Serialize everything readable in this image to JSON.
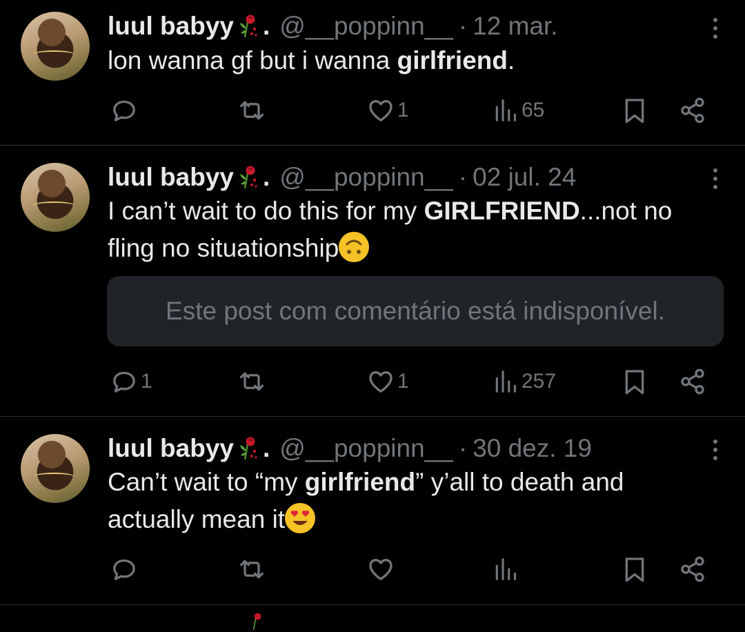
{
  "tweets": [
    {
      "name": "luul babyy",
      "name_suffix": ".",
      "handle": "@__poppinn__",
      "separator": "·",
      "date": "12 mar.",
      "text_parts": [
        "lon wanna gf but i wanna ",
        "girlfriend",
        "."
      ],
      "replies": "",
      "retweets": "",
      "likes": "1",
      "views": "65"
    },
    {
      "name": "luul babyy",
      "name_suffix": ".",
      "handle": "@__poppinn__",
      "separator": "·",
      "date": "02 jul. 24",
      "text_parts": [
        "I can’t wait to do this for my ",
        "GIRLFRIEND",
        "...not no fling no situationship"
      ],
      "emoji": "upside-down-face-emoji",
      "quote_text": "Este post com comentário está indisponível.",
      "replies": "1",
      "retweets": "",
      "likes": "1",
      "views": "257"
    },
    {
      "name": "luul babyy",
      "name_suffix": ".",
      "handle": "@__poppinn__",
      "separator": "·",
      "date": "30 dez. 19",
      "text_parts": [
        "Can’t wait to “my ",
        "girlfriend",
        "” y’all to death and actually mean it"
      ],
      "emoji": "heart-eyes-emoji",
      "replies": "",
      "retweets": "",
      "likes": "",
      "views": ""
    }
  ],
  "colors": {
    "background": "#000000",
    "text": "#e7e9ea",
    "muted": "#71767b",
    "divider": "#2f3336",
    "quote_bg": "#202327"
  }
}
